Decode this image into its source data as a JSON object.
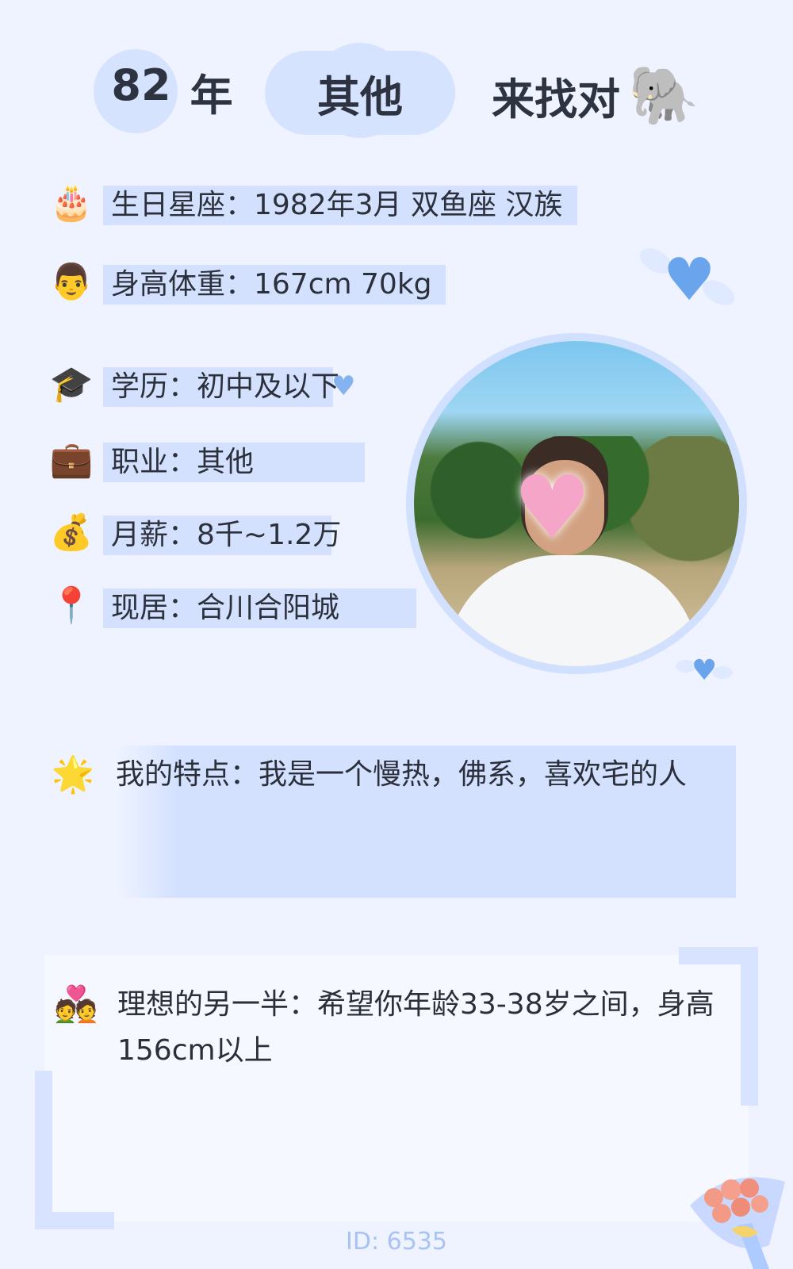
{
  "header": {
    "age_number": "82",
    "age_unit": "年",
    "type": "其他",
    "find_text": "来找对",
    "find_emoji": "🐘"
  },
  "info_rows": [
    {
      "icon": "🎂",
      "icon_name": "birthday-cake-icon",
      "text": "生日星座：1982年3月 双鱼座 汉族"
    },
    {
      "icon": "👨",
      "icon_name": "man-face-icon",
      "text": "身高体重：167cm 70kg"
    },
    {
      "icon": "🎓",
      "icon_name": "graduation-cap-icon",
      "text": "学历：初中及以下"
    },
    {
      "icon": "💼",
      "icon_name": "briefcase-icon",
      "text": "职业：其他"
    },
    {
      "icon": "💰",
      "icon_name": "money-bag-icon",
      "text": "月薪：8千~1.2万"
    },
    {
      "icon": "📍",
      "icon_name": "location-pin-icon",
      "text": "现居：合川合阳城"
    }
  ],
  "features": {
    "icon": "🌟",
    "text": "我的特点：我是一个慢热，佛系，喜欢宅的人"
  },
  "ideal": {
    "icon": "💑",
    "text": "理想的另一半：希望你年龄33-38岁之间，身高156cm以上"
  },
  "footer": {
    "id_text": "ID: 6535"
  },
  "colors": {
    "background": "#eef3ff",
    "highlight": "#d3e1ff",
    "accent_blue": "#6aa4ec",
    "id_text": "#a9c2f5"
  }
}
